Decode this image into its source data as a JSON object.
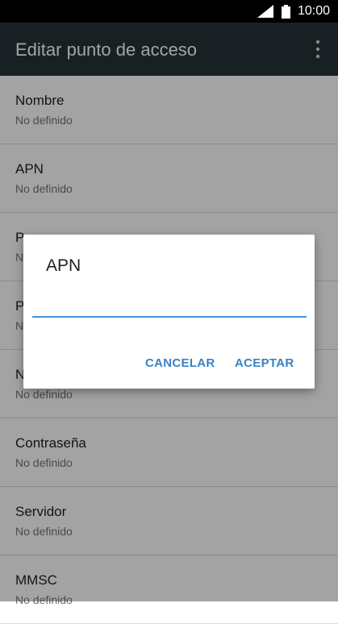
{
  "status_bar": {
    "time": "10:00",
    "icons": [
      "signal-icon",
      "battery-icon"
    ]
  },
  "app_bar": {
    "title": "Editar punto de acceso",
    "menu_icon": "more-vert-icon"
  },
  "settings": [
    {
      "title": "Nombre",
      "value": "No definido"
    },
    {
      "title": "APN",
      "value": "No definido"
    },
    {
      "title": "P",
      "value": "N"
    },
    {
      "title": "P",
      "value": "N"
    },
    {
      "title": "N",
      "value": "No definido"
    },
    {
      "title": "Contraseña",
      "value": "No definido"
    },
    {
      "title": "Servidor",
      "value": "No definido"
    },
    {
      "title": "MMSC",
      "value": "No definido"
    }
  ],
  "dialog": {
    "title": "APN",
    "input_value": "",
    "cancel_label": "CANCELAR",
    "ok_label": "ACEPTAR"
  },
  "colors": {
    "app_bar": "#263238",
    "accent": "#3b82c4",
    "input_underline": "#4a90d9"
  }
}
